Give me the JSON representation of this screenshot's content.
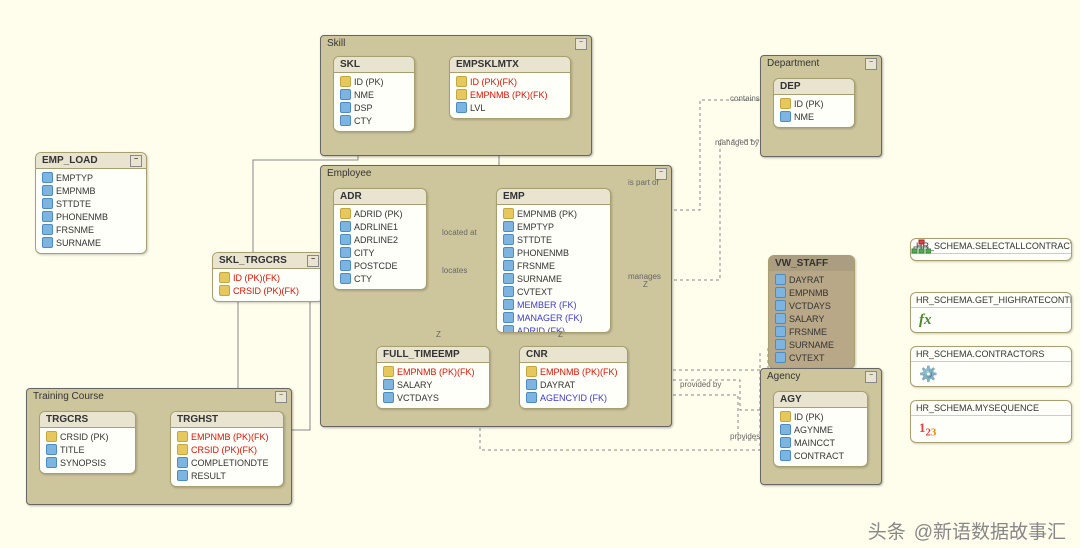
{
  "emp_load": {
    "title": "EMP_LOAD",
    "attrs": [
      {
        "n": "EMPTYP"
      },
      {
        "n": "EMPNMB"
      },
      {
        "n": "STTDTE"
      },
      {
        "n": "PHONENMB"
      },
      {
        "n": "FRSNME"
      },
      {
        "n": "SURNAME"
      }
    ]
  },
  "skl_trgcrs": {
    "title": "SKL_TRGCRS",
    "attrs": [
      {
        "n": "ID (PK)(FK)",
        "k": 1
      },
      {
        "n": "CRSID (PK)(FK)",
        "k": 1
      }
    ]
  },
  "training": {
    "title": "Training Course",
    "trgcrs": {
      "title": "TRGCRS",
      "attrs": [
        {
          "n": "CRSID (PK)",
          "key": 1
        },
        {
          "n": "TITLE"
        },
        {
          "n": "SYNOPSIS"
        }
      ]
    },
    "trghst": {
      "title": "TRGHST",
      "attrs": [
        {
          "n": "EMPNMB (PK)(FK)",
          "k": 1
        },
        {
          "n": "CRSID (PK)(FK)",
          "k": 1
        },
        {
          "n": "COMPLETIONDTE"
        },
        {
          "n": "RESULT"
        }
      ]
    }
  },
  "skill": {
    "title": "Skill",
    "skl": {
      "title": "SKL",
      "attrs": [
        {
          "n": "ID (PK)",
          "key": 1
        },
        {
          "n": "NME"
        },
        {
          "n": "DSP"
        },
        {
          "n": "CTY"
        }
      ]
    },
    "mtx": {
      "title": "EMPSKLMTX",
      "attrs": [
        {
          "n": "ID (PK)(FK)",
          "k": 1
        },
        {
          "n": "EMPNMB (PK)(FK)",
          "k": 1
        },
        {
          "n": "LVL"
        }
      ]
    }
  },
  "employee": {
    "title": "Employee",
    "adr": {
      "title": "ADR",
      "attrs": [
        {
          "n": "ADRID (PK)",
          "key": 1
        },
        {
          "n": "ADRLINE1"
        },
        {
          "n": "ADRLINE2"
        },
        {
          "n": "CITY"
        },
        {
          "n": "POSTCDE"
        },
        {
          "n": "CTY"
        }
      ]
    },
    "emp": {
      "title": "EMP",
      "attrs": [
        {
          "n": "EMPNMB (PK)",
          "key": 1
        },
        {
          "n": "EMPTYP"
        },
        {
          "n": "STTDTE"
        },
        {
          "n": "PHONENMB"
        },
        {
          "n": "FRSNME"
        },
        {
          "n": "SURNAME"
        },
        {
          "n": "CVTEXT"
        },
        {
          "n": "MEMBER (FK)",
          "fk": 1
        },
        {
          "n": "MANAGER (FK)",
          "fk": 1
        },
        {
          "n": "ADRID (FK)",
          "fk": 1
        }
      ]
    },
    "ft": {
      "title": "FULL_TIMEEMP",
      "attrs": [
        {
          "n": "EMPNMB (PK)(FK)",
          "k": 1
        },
        {
          "n": "SALARY"
        },
        {
          "n": "VCTDAYS"
        }
      ]
    },
    "cnr": {
      "title": "CNR",
      "attrs": [
        {
          "n": "EMPNMB (PK)(FK)",
          "k": 1
        },
        {
          "n": "DAYRAT"
        },
        {
          "n": "AGENCYID (FK)",
          "fk": 1
        }
      ]
    }
  },
  "department": {
    "title": "Department",
    "dep": {
      "title": "DEP",
      "attrs": [
        {
          "n": "ID (PK)",
          "key": 1
        },
        {
          "n": "NME"
        }
      ]
    }
  },
  "vw_staff": {
    "title": "VW_STAFF",
    "attrs": [
      {
        "n": "DAYRAT"
      },
      {
        "n": "EMPNMB"
      },
      {
        "n": "VCTDAYS"
      },
      {
        "n": "SALARY"
      },
      {
        "n": "FRSNME"
      },
      {
        "n": "SURNAME"
      },
      {
        "n": "CVTEXT"
      }
    ]
  },
  "agency": {
    "title": "Agency",
    "agy": {
      "title": "AGY",
      "attrs": [
        {
          "n": "ID (PK)",
          "key": 1
        },
        {
          "n": "AGYNME"
        },
        {
          "n": "MAINCCT"
        },
        {
          "n": "CONTRACT"
        }
      ]
    }
  },
  "schemas": [
    {
      "n": "HR_SCHEMA.SELECTALLCONTRACTORS",
      "i": "tree"
    },
    {
      "n": "HR_SCHEMA.GET_HIGHRATECONTRACTORS",
      "i": "fx"
    },
    {
      "n": "HR_SCHEMA.CONTRACTORS",
      "i": "gear"
    },
    {
      "n": "HR_SCHEMA.MYSEQUENCE",
      "i": "num"
    }
  ],
  "rels": {
    "contains": "contains",
    "managed": "managed by",
    "ispart": "is part of",
    "manages": "manages",
    "located": "located at",
    "locates": "locates",
    "provided": "provided by",
    "provides": "provides",
    "z": "Z"
  },
  "footer": {
    "tag": "头条",
    "author": "@新语数据故事汇"
  },
  "chart_data": {
    "type": "er-diagram",
    "entities": [
      {
        "name": "EMP_LOAD",
        "group": null,
        "columns": [
          "EMPTYP",
          "EMPNMB",
          "STTDTE",
          "PHONENMB",
          "FRSNME",
          "SURNAME"
        ]
      },
      {
        "name": "SKL_TRGCRS",
        "group": null,
        "columns": [
          "ID (PK)(FK)",
          "CRSID (PK)(FK)"
        ]
      },
      {
        "name": "SKL",
        "group": "Skill",
        "columns": [
          "ID (PK)",
          "NME",
          "DSP",
          "CTY"
        ]
      },
      {
        "name": "EMPSKLMTX",
        "group": "Skill",
        "columns": [
          "ID (PK)(FK)",
          "EMPNMB (PK)(FK)",
          "LVL"
        ]
      },
      {
        "name": "ADR",
        "group": "Employee",
        "columns": [
          "ADRID (PK)",
          "ADRLINE1",
          "ADRLINE2",
          "CITY",
          "POSTCDE",
          "CTY"
        ]
      },
      {
        "name": "EMP",
        "group": "Employee",
        "columns": [
          "EMPNMB (PK)",
          "EMPTYP",
          "STTDTE",
          "PHONENMB",
          "FRSNME",
          "SURNAME",
          "CVTEXT",
          "MEMBER (FK)",
          "MANAGER (FK)",
          "ADRID (FK)"
        ]
      },
      {
        "name": "FULL_TIMEEMP",
        "group": "Employee",
        "columns": [
          "EMPNMB (PK)(FK)",
          "SALARY",
          "VCTDAYS"
        ]
      },
      {
        "name": "CNR",
        "group": "Employee",
        "columns": [
          "EMPNMB (PK)(FK)",
          "DAYRAT",
          "AGENCYID (FK)"
        ]
      },
      {
        "name": "TRGCRS",
        "group": "Training Course",
        "columns": [
          "CRSID (PK)",
          "TITLE",
          "SYNOPSIS"
        ]
      },
      {
        "name": "TRGHST",
        "group": "Training Course",
        "columns": [
          "EMPNMB (PK)(FK)",
          "CRSID (PK)(FK)",
          "COMPLETIONDTE"
        ]
      },
      {
        "name": "DEP",
        "group": "Department",
        "columns": [
          "ID (PK)",
          "NME"
        ]
      },
      {
        "name": "VW_STAFF",
        "group": null,
        "type": "view",
        "columns": [
          "DAYRAT",
          "EMPNMB",
          "VCTDAYS",
          "SALARY",
          "FRSNME",
          "SURNAME",
          "CVTEXT"
        ]
      },
      {
        "name": "AGY",
        "group": "Agency",
        "columns": [
          "ID (PK)",
          "AGYNME",
          "MAINCCT",
          "CONTRACT"
        ]
      }
    ],
    "relationships": [
      {
        "from": "SKL",
        "to": "EMPSKLMTX"
      },
      {
        "from": "EMP",
        "to": "EMPSKLMTX",
        "label": "is part of"
      },
      {
        "from": "ADR",
        "to": "EMP",
        "label": "located at / locates"
      },
      {
        "from": "EMP",
        "to": "DEP",
        "label": "contains / managed by"
      },
      {
        "from": "EMP",
        "to": "EMP",
        "label": "manages"
      },
      {
        "from": "EMP",
        "to": "FULL_TIMEEMP",
        "label": "Z"
      },
      {
        "from": "EMP",
        "to": "CNR",
        "label": "Z"
      },
      {
        "from": "CNR",
        "to": "AGY",
        "label": "provided by / provides"
      },
      {
        "from": "TRGCRS",
        "to": "TRGHST"
      },
      {
        "from": "TRGHST",
        "to": "EMP"
      },
      {
        "from": "SKL",
        "to": "SKL_TRGCRS"
      },
      {
        "from": "TRGCRS",
        "to": "SKL_TRGCRS"
      },
      {
        "from": "FULL_TIMEEMP",
        "to": "VW_STAFF"
      },
      {
        "from": "CNR",
        "to": "VW_STAFF"
      }
    ],
    "other_objects": [
      "HR_SCHEMA.SELECTALLCONTRACTORS",
      "HR_SCHEMA.GET_HIGHRATECONTRACTORS",
      "HR_SCHEMA.CONTRACTORS",
      "HR_SCHEMA.MYSEQUENCE"
    ]
  }
}
